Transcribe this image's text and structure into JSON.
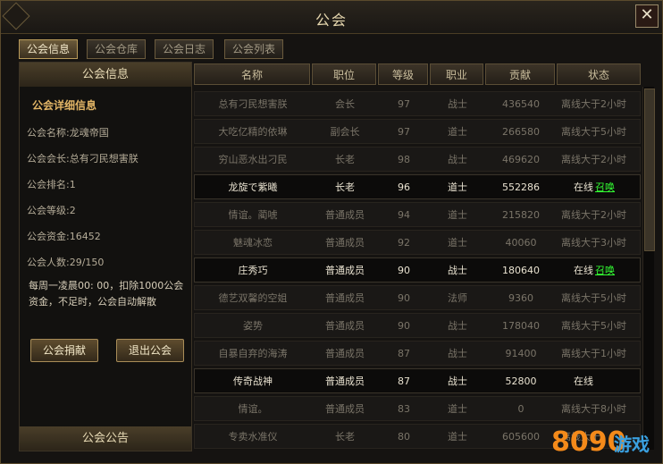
{
  "window": {
    "title": "公会",
    "close_label": "✕"
  },
  "tabs": [
    {
      "label": "公会信息",
      "active": true
    },
    {
      "label": "公会仓库",
      "active": false
    },
    {
      "label": "公会日志",
      "active": false
    },
    {
      "label": "公会列表",
      "active": false
    }
  ],
  "left": {
    "header": "公会信息",
    "detail_title": "公会详细信息",
    "rows": [
      "公会名称:龙魂帝国",
      "公会会长:总有刁民想害朕",
      "公会排名:1",
      "公会等级:2",
      "公会资金:16452",
      "公会人数:29/150"
    ],
    "notice": "每周一凌晨00: 00，扣除1000公会资金，不足时，公会自动解散",
    "donate_label": "公会捐献",
    "leave_label": "退出公会",
    "footer": "公会公告"
  },
  "table": {
    "headers": [
      "名称",
      "职位",
      "等级",
      "职业",
      "贡献",
      "状态"
    ],
    "summon_label": "召唤",
    "rows": [
      {
        "name": "总有刁民想害朕",
        "position": "会长",
        "level": "97",
        "class": "战士",
        "contribution": "436540",
        "status": "离线大于2小时",
        "online": false,
        "summon": false
      },
      {
        "name": "大吃亿精的依琳",
        "position": "副会长",
        "level": "97",
        "class": "道士",
        "contribution": "266580",
        "status": "离线大于5小时",
        "online": false,
        "summon": false
      },
      {
        "name": "穷山恶水出刁民",
        "position": "长老",
        "level": "98",
        "class": "战士",
        "contribution": "469620",
        "status": "离线大于2小时",
        "online": false,
        "summon": false
      },
      {
        "name": "龙旋で紫曦",
        "position": "长老",
        "level": "96",
        "class": "道士",
        "contribution": "552286",
        "status": "在线",
        "online": true,
        "summon": true
      },
      {
        "name": "情谊。蔺唬",
        "position": "普通成员",
        "level": "94",
        "class": "道士",
        "contribution": "215820",
        "status": "离线大于2小时",
        "online": false,
        "summon": false
      },
      {
        "name": "魅魂冰恋",
        "position": "普通成员",
        "level": "92",
        "class": "道士",
        "contribution": "40060",
        "status": "离线大于3小时",
        "online": false,
        "summon": false
      },
      {
        "name": "庄秀巧",
        "position": "普通成员",
        "level": "90",
        "class": "战士",
        "contribution": "180640",
        "status": "在线",
        "online": true,
        "summon": true
      },
      {
        "name": "德艺双馨的空姐",
        "position": "普通成员",
        "level": "90",
        "class": "法师",
        "contribution": "9360",
        "status": "离线大于5小时",
        "online": false,
        "summon": false
      },
      {
        "name": "姿势",
        "position": "普通成员",
        "level": "90",
        "class": "战士",
        "contribution": "178040",
        "status": "离线大于5小时",
        "online": false,
        "summon": false
      },
      {
        "name": "自暴自弃的海涛",
        "position": "普通成员",
        "level": "87",
        "class": "战士",
        "contribution": "91400",
        "status": "离线大于1小时",
        "online": false,
        "summon": false
      },
      {
        "name": "传奇战神",
        "position": "普通成员",
        "level": "87",
        "class": "战士",
        "contribution": "52800",
        "status": "在线",
        "online": true,
        "summon": false
      },
      {
        "name": "情谊。",
        "position": "普通成员",
        "level": "83",
        "class": "道士",
        "contribution": "0",
        "status": "离线大于8小时",
        "online": false,
        "summon": false
      },
      {
        "name": "专卖水准仪",
        "position": "长老",
        "level": "80",
        "class": "道士",
        "contribution": "605600",
        "status": "离线大于",
        "online": false,
        "summon": false
      }
    ]
  },
  "watermark": {
    "brand": "8090",
    "text": "游戏"
  }
}
